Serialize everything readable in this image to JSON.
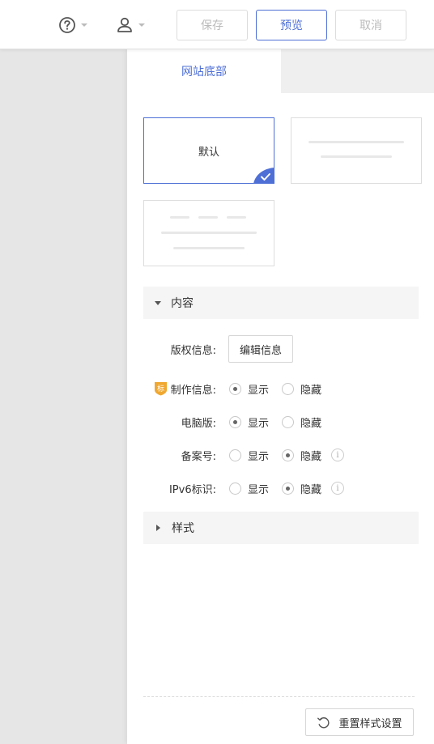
{
  "topbar": {
    "help_icon": "help-circle-icon",
    "user_icon": "user-icon",
    "save_label": "保存",
    "preview_label": "预览",
    "cancel_label": "取消"
  },
  "tabs": [
    {
      "label": "网站底部",
      "active": true
    }
  ],
  "templates": [
    {
      "label": "默认",
      "selected": true
    },
    {
      "label": "",
      "selected": false
    },
    {
      "label": "",
      "selected": false
    }
  ],
  "sections": {
    "content": {
      "title": "内容",
      "expanded": true
    },
    "style": {
      "title": "样式",
      "expanded": false
    }
  },
  "fields": {
    "copyright": {
      "label": "版权信息:",
      "button": "编辑信息"
    },
    "producer": {
      "label": "制作信息:",
      "badge": "标",
      "options": [
        "显示",
        "隐藏"
      ],
      "selected": "显示"
    },
    "desktop": {
      "label": "电脑版:",
      "options": [
        "显示",
        "隐藏"
      ],
      "selected": "显示"
    },
    "icp": {
      "label": "备案号:",
      "options": [
        "显示",
        "隐藏"
      ],
      "selected": "隐藏",
      "info": "i"
    },
    "ipv6": {
      "label": "IPv6标识:",
      "options": [
        "显示",
        "隐藏"
      ],
      "selected": "隐藏",
      "info": "i"
    }
  },
  "footer": {
    "reset_label": "重置样式设置",
    "reset_icon": "reset-icon"
  },
  "colors": {
    "accent": "#4e6fd6",
    "badge": "#f0a830"
  }
}
